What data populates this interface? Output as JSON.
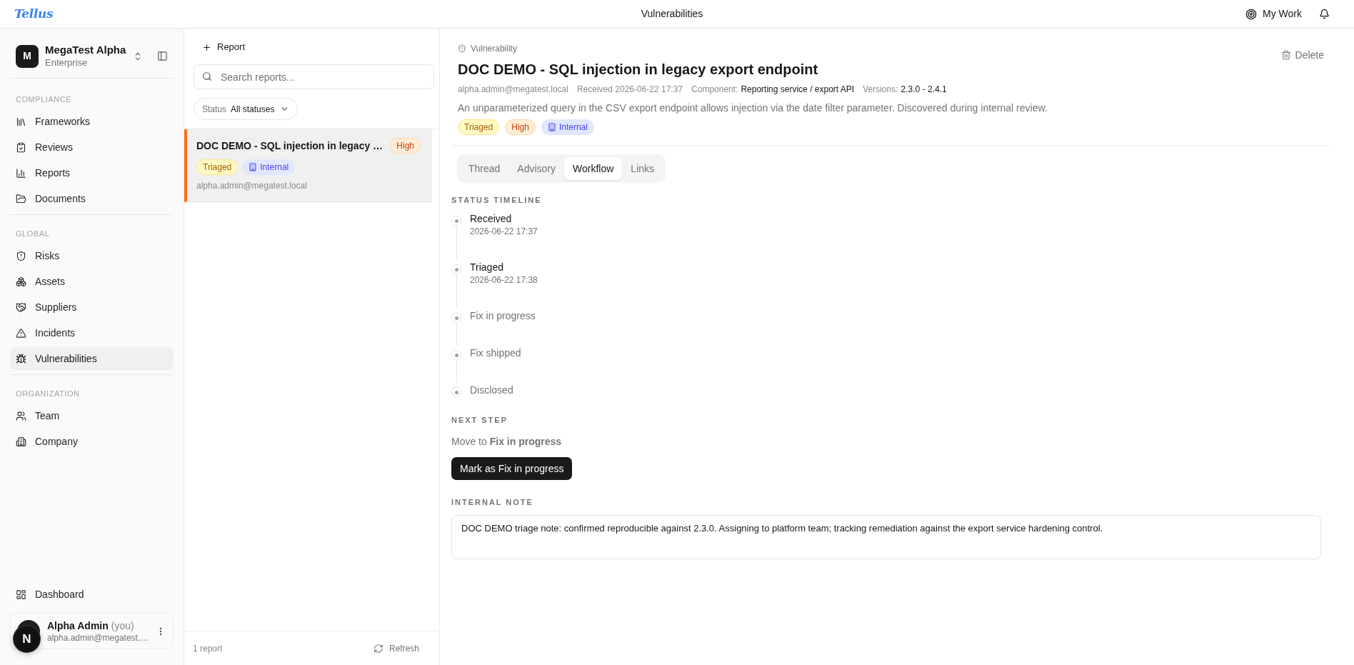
{
  "header": {
    "logo": "Tellus",
    "title": "Vulnerabilities",
    "my_work": "My Work"
  },
  "sidebar": {
    "workspace": {
      "initial": "M",
      "name": "MegaTest Alpha",
      "plan": "Enterprise"
    },
    "sections": [
      {
        "label": "COMPLIANCE",
        "items": [
          {
            "label": "Frameworks",
            "selected": false
          },
          {
            "label": "Reviews",
            "selected": false
          },
          {
            "label": "Reports",
            "selected": false
          },
          {
            "label": "Documents",
            "selected": false
          }
        ]
      },
      {
        "label": "GLOBAL",
        "items": [
          {
            "label": "Risks",
            "selected": false
          },
          {
            "label": "Assets",
            "selected": false
          },
          {
            "label": "Suppliers",
            "selected": false
          },
          {
            "label": "Incidents",
            "selected": false
          },
          {
            "label": "Vulnerabilities",
            "selected": true
          }
        ]
      },
      {
        "label": "ORGANIZATION",
        "items": [
          {
            "label": "Team",
            "selected": false
          },
          {
            "label": "Company",
            "selected": false
          }
        ]
      }
    ],
    "footer_items": [
      {
        "label": "Dashboard",
        "selected": false
      }
    ],
    "user": {
      "name": "Alpha Admin",
      "suffix": "(you)",
      "email": "alpha.admin@megatest.…"
    }
  },
  "dev_badge": {
    "label": "N"
  },
  "report_list": {
    "new_button": "Report",
    "search": {
      "placeholder": "Search reports..."
    },
    "filter": {
      "label": "Status",
      "value": "All statuses"
    },
    "reports": [
      {
        "title": "DOC DEMO - SQL injection in legacy …",
        "severity": {
          "label": "High",
          "kind": "severity"
        },
        "selected": true,
        "tags": [
          {
            "label": "Triaged",
            "kind": "status"
          },
          {
            "label": "Internal",
            "kind": "visibility"
          }
        ],
        "reporter": "alpha.admin@megatest.local"
      }
    ],
    "count": "1 report",
    "refresh": "Refresh"
  },
  "detail": {
    "eyebrow": "Vulnerability",
    "title": "DOC DEMO - SQL injection in legacy export endpoint",
    "delete": "Delete",
    "meta": [
      {
        "text": "alpha.admin@megatest.local"
      },
      {
        "text": "Received 2026-06-22 17:37"
      },
      {
        "label": "Component:",
        "value": "Reporting service / export API"
      },
      {
        "label": "Versions:",
        "value": "2.3.0 - 2.4.1"
      }
    ],
    "description": "An unparameterized query in the CSV export endpoint allows injection via the date filter parameter. Discovered during internal review.",
    "badges": [
      {
        "label": "Triaged",
        "kind": "status"
      },
      {
        "label": "High",
        "kind": "severity"
      },
      {
        "label": "Internal",
        "kind": "visibility"
      }
    ],
    "tabs": [
      {
        "label": "Thread",
        "selected": false
      },
      {
        "label": "Advisory",
        "selected": false
      },
      {
        "label": "Workflow",
        "selected": true
      },
      {
        "label": "Links",
        "selected": false
      }
    ],
    "timeline": {
      "label": "STATUS TIMELINE",
      "steps": [
        {
          "title": "Received",
          "time": "2026-06-22 17:37",
          "done": true
        },
        {
          "title": "Triaged",
          "time": "2026-06-22 17:38",
          "done": true
        },
        {
          "title": "Fix in progress",
          "done": false
        },
        {
          "title": "Fix shipped",
          "done": false
        },
        {
          "title": "Disclosed",
          "done": false
        }
      ]
    },
    "next_step": {
      "label": "NEXT STEP",
      "text": "Move to **Fix in progress**",
      "button": "Mark as Fix in progress"
    },
    "note": {
      "label": "INTERNAL NOTE",
      "value": "DOC DEMO triage note: confirmed reproducible against 2.3.0. Assigning to platform team; tracking remediation against the export service hardening control."
    }
  }
}
